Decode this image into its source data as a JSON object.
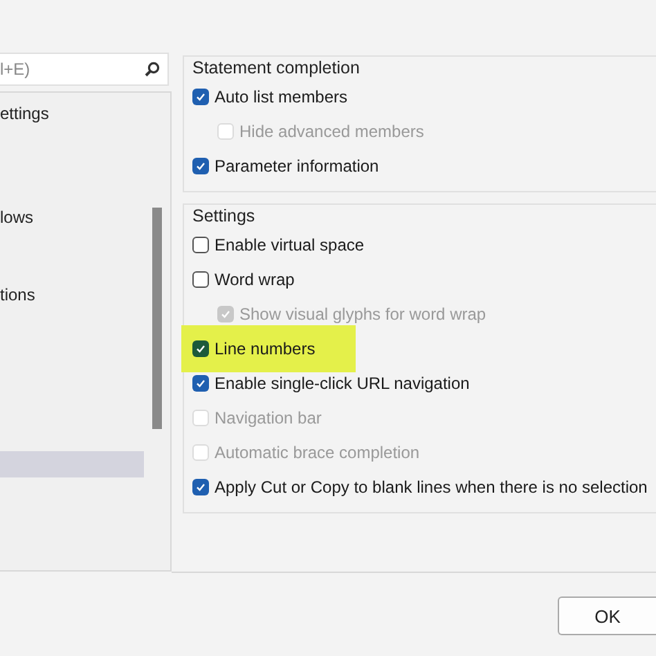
{
  "search": {
    "placeholder": "l+E)"
  },
  "tree": {
    "items": [
      {
        "label": "ettings",
        "selected": false
      },
      {
        "label": "lows",
        "selected": false
      },
      {
        "label": "tions",
        "selected": false
      },
      {
        "selected": true
      }
    ]
  },
  "groups": [
    {
      "title": "Statement completion",
      "options": [
        {
          "label": "Auto list members",
          "checked": true,
          "disabled": false,
          "highlighted": false,
          "children": [
            {
              "label": "Hide advanced members",
              "checked": false,
              "disabled": true,
              "highlighted": false
            }
          ]
        },
        {
          "label": "Parameter information",
          "checked": true,
          "disabled": false,
          "highlighted": false
        }
      ]
    },
    {
      "title": "Settings",
      "options": [
        {
          "label": "Enable virtual space",
          "checked": false,
          "disabled": false,
          "highlighted": false
        },
        {
          "label": "Word wrap",
          "checked": false,
          "disabled": false,
          "highlighted": false,
          "children": [
            {
              "label": "Show visual glyphs for word wrap",
              "checked": true,
              "disabled": true,
              "highlighted": false
            }
          ]
        },
        {
          "label": "Line numbers",
          "checked": true,
          "disabled": false,
          "highlighted": true
        },
        {
          "label": "Enable single-click URL navigation",
          "checked": true,
          "disabled": false,
          "highlighted": false
        },
        {
          "label": "Navigation bar",
          "checked": false,
          "disabled": true,
          "highlighted": false
        },
        {
          "label": "Automatic brace completion",
          "checked": false,
          "disabled": true,
          "highlighted": false
        },
        {
          "label": "Apply Cut or Copy to blank lines when there is no selection",
          "checked": true,
          "disabled": false,
          "highlighted": false
        }
      ]
    }
  ],
  "buttons": [
    {
      "label": "OK"
    }
  ]
}
